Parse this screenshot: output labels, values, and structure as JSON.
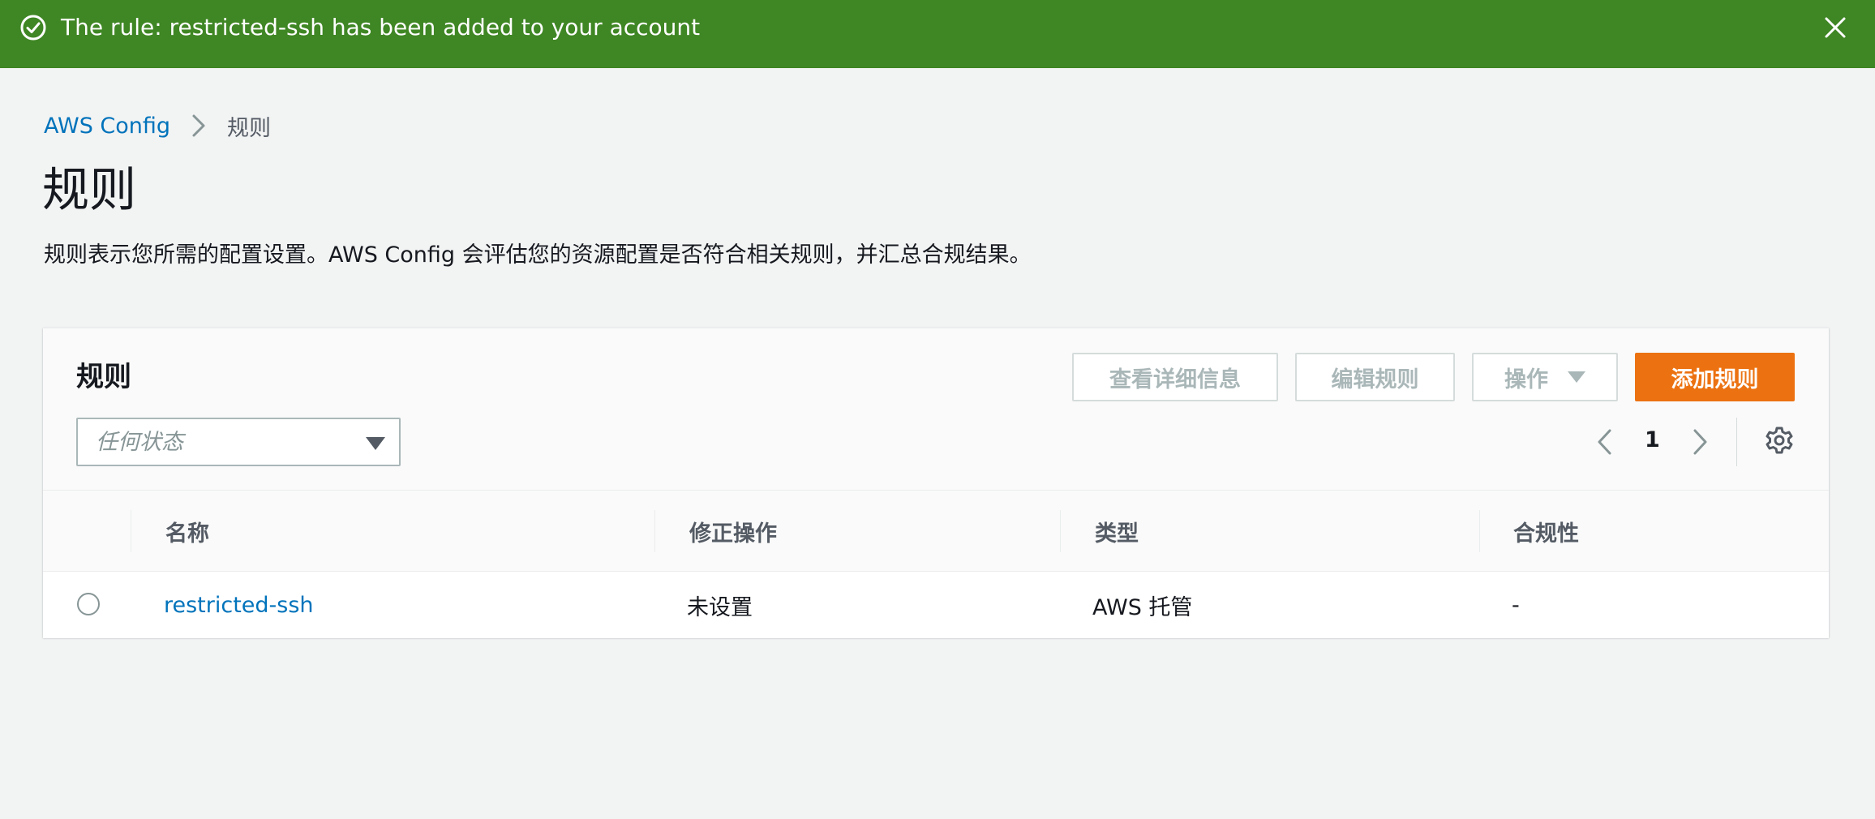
{
  "flash": {
    "message": "The rule: restricted-ssh has been added to your account",
    "color": "#3f8624",
    "icon": "check-circle-icon",
    "close_icon": "close-icon"
  },
  "breadcrumb": {
    "root": "AWS Config",
    "current": "规则"
  },
  "page": {
    "title": "规则",
    "description": "规则表示您所需的配置设置。AWS Config 会评估您的资源配置是否符合相关规则，并汇总合规结果。"
  },
  "panel": {
    "title": "规则",
    "buttons": {
      "view_details": "查看详细信息",
      "edit_rule": "编辑规则",
      "actions": "操作",
      "add_rule": "添加规则"
    },
    "primary_color": "#ec7211",
    "filter": {
      "placeholder": "任何状态"
    },
    "pagination": {
      "current_page": "1"
    }
  },
  "table": {
    "columns": [
      "名称",
      "修正操作",
      "类型",
      "合规性"
    ],
    "rows": [
      {
        "name": "restricted-ssh",
        "remediation": "未设置",
        "type": "AWS 托管",
        "compliance": "-"
      }
    ]
  }
}
